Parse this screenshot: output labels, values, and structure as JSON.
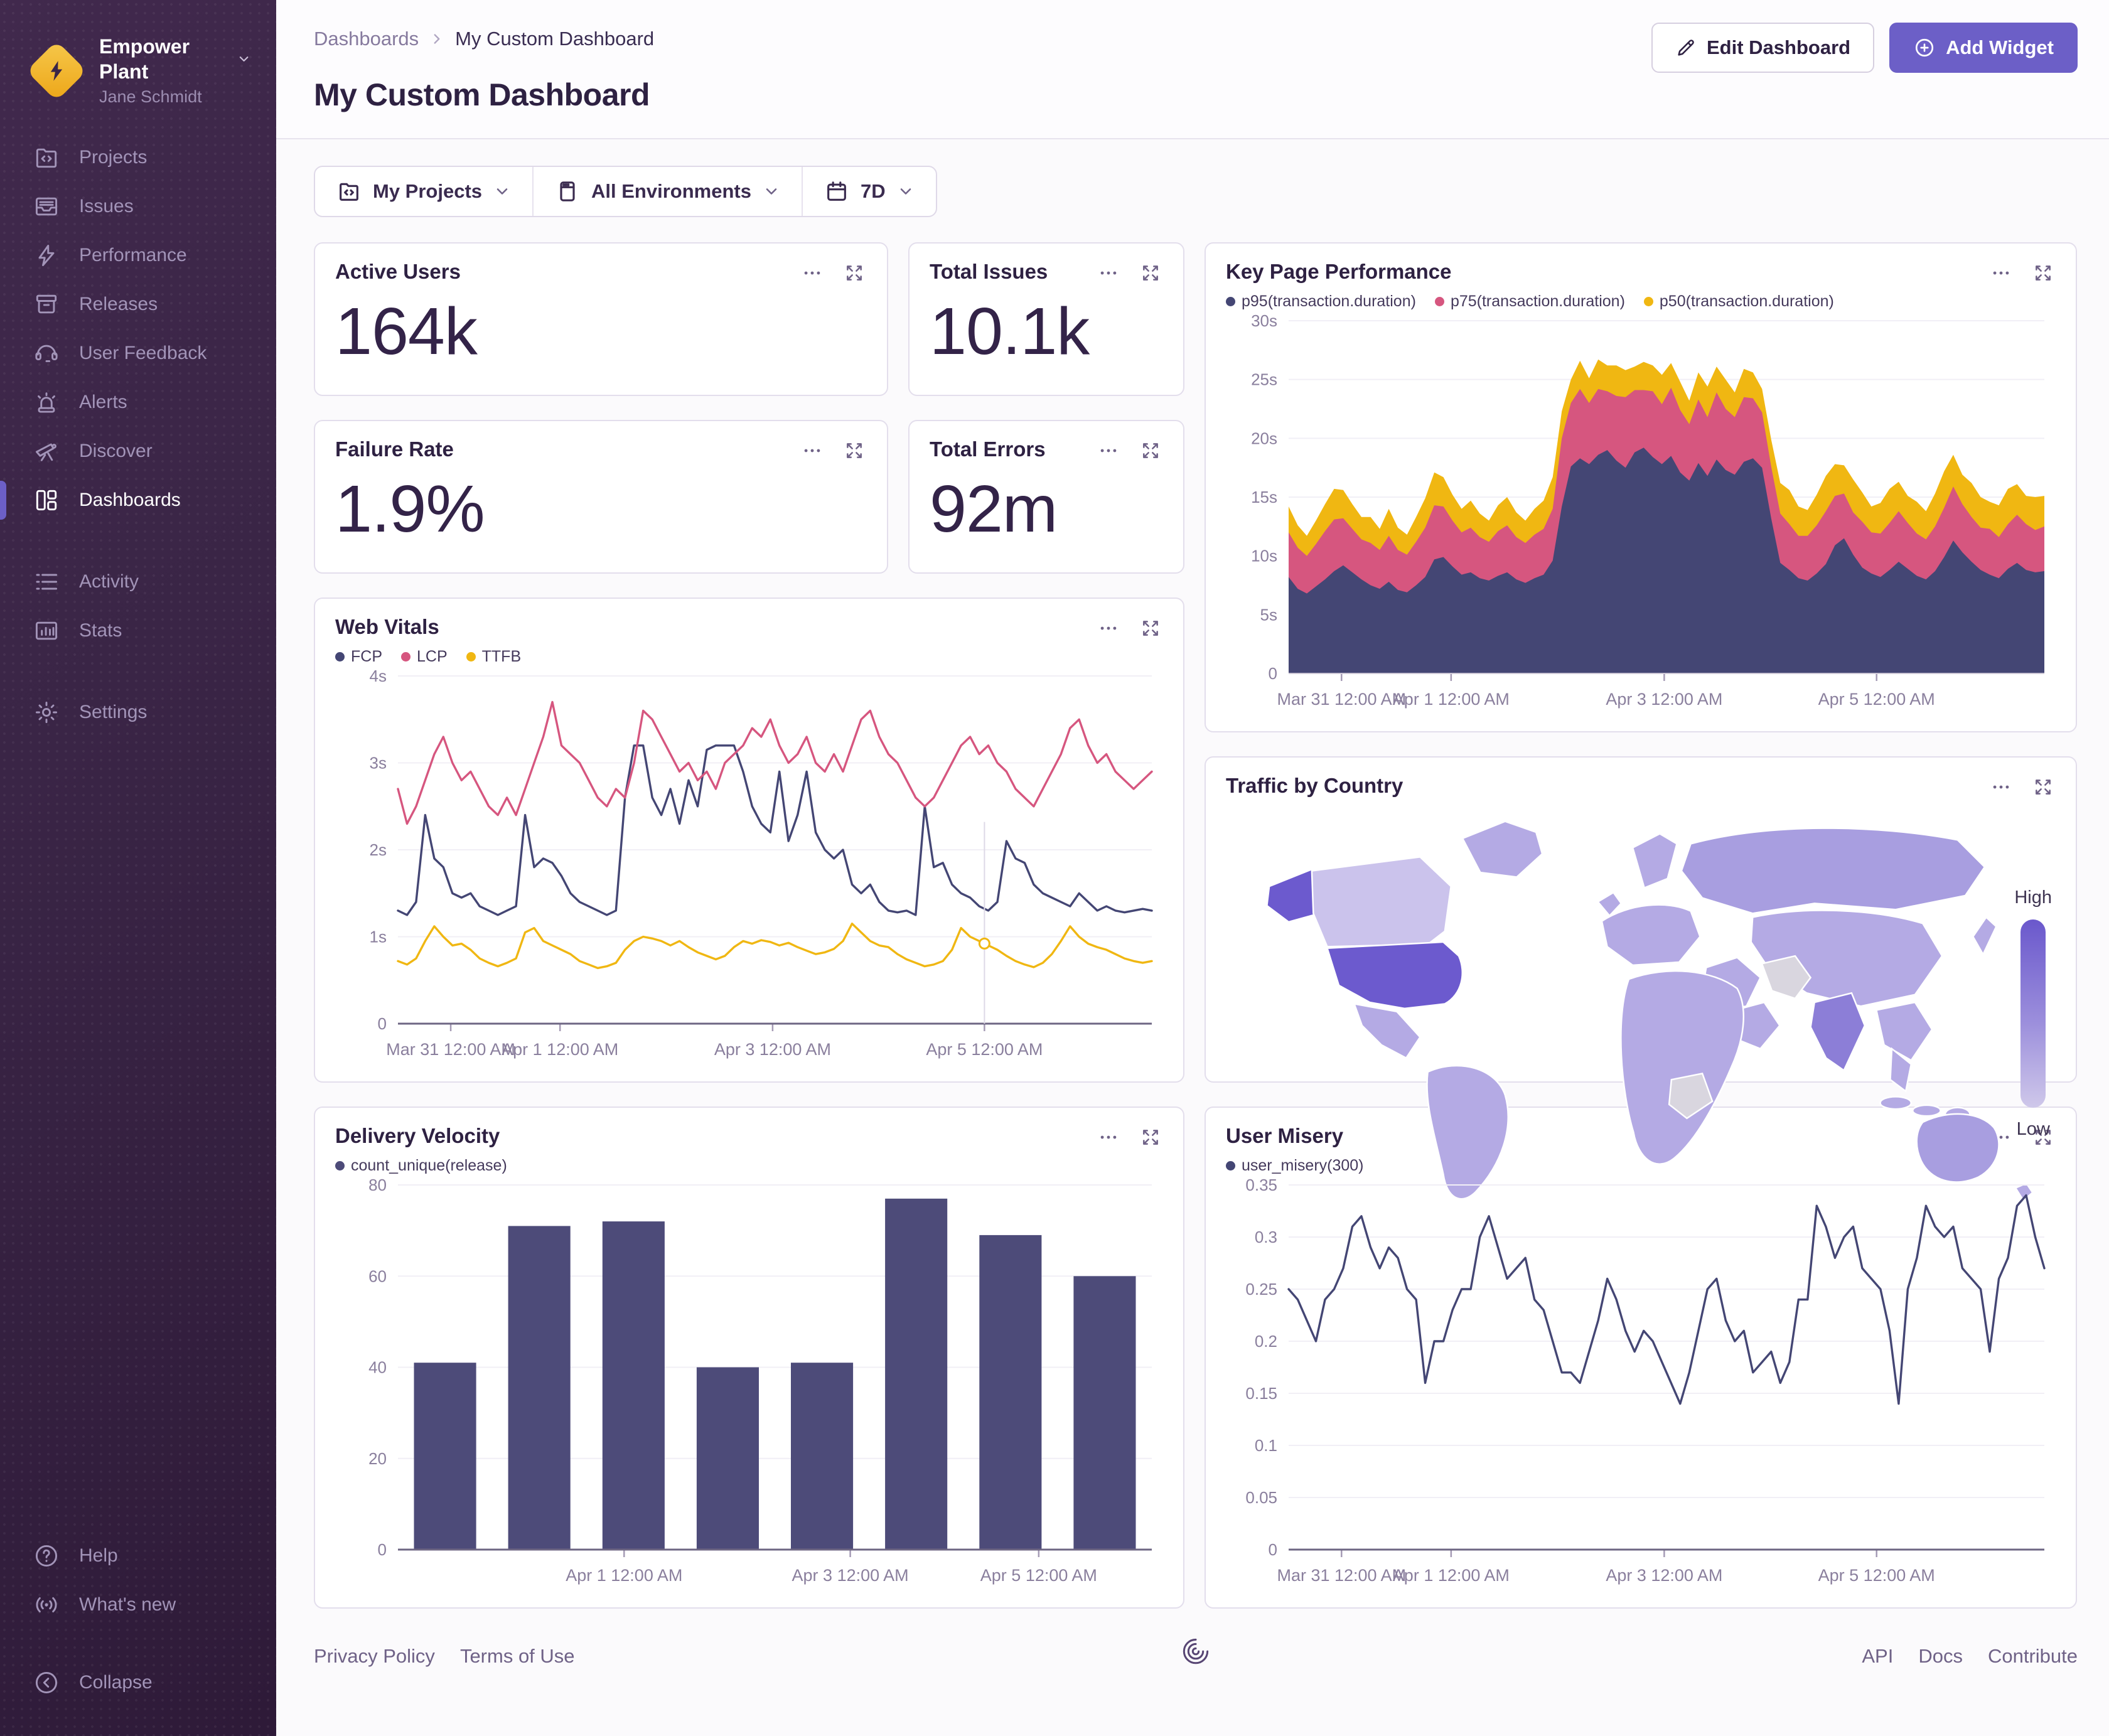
{
  "colors": {
    "accent": "#6C5FC7",
    "navy": "#444674",
    "pink": "#d6567f",
    "yellow": "#f0b712",
    "sidebar_bg": "#34203f",
    "text_dark": "#2e2142"
  },
  "sidebar": {
    "org": {
      "name": "Empower Plant",
      "user": "Jane Schmidt"
    },
    "items": [
      {
        "id": "projects",
        "label": "Projects",
        "group": 1
      },
      {
        "id": "issues",
        "label": "Issues",
        "group": 1
      },
      {
        "id": "performance",
        "label": "Performance",
        "group": 1
      },
      {
        "id": "releases",
        "label": "Releases",
        "group": 1
      },
      {
        "id": "feedback",
        "label": "User Feedback",
        "group": 1
      },
      {
        "id": "alerts",
        "label": "Alerts",
        "group": 1
      },
      {
        "id": "discover",
        "label": "Discover",
        "group": 1
      },
      {
        "id": "dashboards",
        "label": "Dashboards",
        "group": 1,
        "active": true
      },
      {
        "id": "activity",
        "label": "Activity",
        "group": 2
      },
      {
        "id": "stats",
        "label": "Stats",
        "group": 2
      },
      {
        "id": "settings",
        "label": "Settings",
        "group": 3
      }
    ],
    "footer_items": [
      {
        "id": "help",
        "label": "Help",
        "group": 1
      },
      {
        "id": "whatsnew",
        "label": "What's new",
        "group": 1
      },
      {
        "id": "collapse",
        "label": "Collapse",
        "group": 2
      }
    ]
  },
  "header": {
    "breadcrumb": {
      "parent": "Dashboards",
      "current": "My Custom Dashboard"
    },
    "title": "My Custom Dashboard",
    "edit_button": "Edit Dashboard",
    "add_button": "Add Widget"
  },
  "filters": {
    "projects": {
      "label": "My Projects"
    },
    "environments": {
      "label": "All Environments"
    },
    "period": {
      "label": "7D"
    }
  },
  "stats": {
    "active_users": {
      "title": "Active Users",
      "value": "164k"
    },
    "total_issues": {
      "title": "Total Issues",
      "value": "10.1k"
    },
    "failure_rate": {
      "title": "Failure Rate",
      "value": "1.9%"
    },
    "total_errors": {
      "title": "Total Errors",
      "value": "92m"
    }
  },
  "chart_data": [
    {
      "id": "key-page-performance",
      "type": "area",
      "stacked": true,
      "title": "Key Page Performance",
      "legend": [
        "p95(transaction.duration)",
        "p75(transaction.duration)",
        "p50(transaction.duration)"
      ],
      "ylim": [
        0,
        30
      ],
      "dark_axis": false,
      "yticks": [
        {
          "v": 0,
          "label": "0"
        },
        {
          "v": 5,
          "label": "5s"
        },
        {
          "v": 10,
          "label": "10s"
        },
        {
          "v": 15,
          "label": "15s"
        },
        {
          "v": 20,
          "label": "20s"
        },
        {
          "v": 25,
          "label": "25s"
        },
        {
          "v": 30,
          "label": "30s"
        }
      ],
      "xticks": [
        {
          "f": 0.07,
          "label": "Mar 31 12:00 AM"
        },
        {
          "f": 0.215,
          "label": "Apr 1 12:00 AM"
        },
        {
          "f": 0.497,
          "label": "Apr 3 12:00 AM"
        },
        {
          "f": 0.778,
          "label": "Apr 5 12:00 AM"
        }
      ],
      "series": [
        {
          "name": "p95(transaction.duration)",
          "color": "#444674",
          "values": [
            8.2,
            7.2,
            6.8,
            7.4,
            8.0,
            8.7,
            9.2,
            8.6,
            8.0,
            7.5,
            7.2,
            7.8,
            7.1,
            6.9,
            7.5,
            8.2,
            9.7,
            9.9,
            9.1,
            8.4,
            8.6,
            8.1,
            7.9,
            8.3,
            8.6,
            8.0,
            7.7,
            8.1,
            8.4,
            9.6,
            14.2,
            17.6,
            18.3,
            17.8,
            18.6,
            19.0,
            18.1,
            17.5,
            18.8,
            19.2,
            18.4,
            17.8,
            18.5,
            17.1,
            16.4,
            17.9,
            16.8,
            18.2,
            17.3,
            16.9,
            18.0,
            18.3,
            17.5,
            13.2,
            9.4,
            8.8,
            8.1,
            7.9,
            8.5,
            9.3,
            10.9,
            11.5,
            10.1,
            9.0,
            8.5,
            8.2,
            8.8,
            9.5,
            8.9,
            8.3,
            8.0,
            8.7,
            9.9,
            11.3,
            10.3,
            9.5,
            8.8,
            8.4,
            8.1,
            8.9,
            9.4,
            8.8,
            8.6,
            8.7
          ]
        },
        {
          "name": "p75(transaction.duration)",
          "color": "#d6567f",
          "values": [
            3.8,
            3.5,
            3.2,
            3.6,
            4.1,
            4.4,
            4.0,
            3.7,
            3.4,
            3.6,
            3.3,
            3.9,
            3.4,
            3.2,
            3.7,
            4.2,
            4.6,
            4.3,
            3.9,
            3.6,
            3.8,
            3.5,
            3.3,
            3.8,
            4.0,
            3.6,
            3.4,
            3.7,
            3.9,
            4.4,
            5.8,
            5.4,
            5.9,
            5.2,
            5.6,
            5.0,
            5.5,
            6.0,
            5.3,
            4.9,
            5.6,
            5.1,
            5.8,
            5.3,
            4.8,
            5.4,
            5.0,
            5.7,
            5.2,
            4.9,
            5.5,
            5.1,
            4.7,
            4.4,
            4.2,
            3.9,
            3.6,
            3.8,
            4.1,
            4.5,
            4.2,
            3.8,
            3.6,
            3.9,
            3.5,
            3.7,
            4.0,
            4.3,
            3.9,
            3.6,
            3.4,
            3.8,
            4.2,
            4.6,
            4.1,
            3.8,
            3.6,
            3.9,
            3.5,
            3.8,
            4.1,
            3.9,
            3.6,
            3.8
          ]
        },
        {
          "name": "p50(transaction.duration)",
          "color": "#f0b712",
          "values": [
            2.2,
            1.9,
            1.7,
            2.0,
            2.3,
            2.6,
            2.4,
            2.1,
            1.9,
            2.2,
            1.8,
            2.3,
            1.9,
            1.7,
            2.1,
            2.5,
            2.8,
            2.5,
            2.2,
            2.0,
            2.3,
            2.0,
            1.8,
            2.2,
            2.4,
            2.1,
            1.9,
            2.2,
            2.4,
            2.7,
            2.3,
            2.0,
            2.4,
            2.1,
            2.5,
            2.2,
            2.6,
            2.3,
            2.0,
            2.4,
            2.2,
            2.5,
            2.1,
            2.4,
            2.0,
            2.3,
            2.6,
            2.2,
            2.5,
            2.1,
            2.4,
            2.2,
            2.0,
            2.3,
            2.6,
            2.9,
            2.5,
            2.2,
            2.6,
            3.0,
            2.7,
            2.4,
            2.8,
            2.5,
            2.2,
            2.6,
            2.9,
            2.5,
            2.3,
            2.7,
            2.4,
            2.8,
            3.1,
            2.7,
            2.5,
            2.9,
            2.6,
            2.3,
            2.7,
            3.0,
            2.6,
            2.4,
            2.8,
            2.6
          ]
        }
      ]
    },
    {
      "id": "web-vitals",
      "type": "line",
      "title": "Web Vitals",
      "legend": [
        "FCP",
        "LCP",
        "TTFB"
      ],
      "ylim": [
        0,
        4
      ],
      "dark_axis": true,
      "yticks": [
        {
          "v": 0,
          "label": "0"
        },
        {
          "v": 1,
          "label": "1s"
        },
        {
          "v": 2,
          "label": "2s"
        },
        {
          "v": 3,
          "label": "3s"
        },
        {
          "v": 4,
          "label": "4s"
        }
      ],
      "xticks": [
        {
          "f": 0.07,
          "label": "Mar 31 12:00 AM"
        },
        {
          "f": 0.215,
          "label": "Apr 1 12:00 AM"
        },
        {
          "f": 0.497,
          "label": "Apr 3 12:00 AM"
        },
        {
          "f": 0.778,
          "label": "Apr 5 12:00 AM"
        }
      ],
      "crosshair": {
        "f": 0.778,
        "series": 2
      },
      "series": [
        {
          "name": "FCP",
          "color": "#444674",
          "values": [
            1.3,
            1.25,
            1.4,
            2.4,
            1.9,
            1.8,
            1.5,
            1.45,
            1.5,
            1.35,
            1.3,
            1.25,
            1.3,
            1.35,
            2.4,
            1.8,
            1.9,
            1.85,
            1.7,
            1.5,
            1.4,
            1.35,
            1.3,
            1.25,
            1.3,
            2.6,
            3.2,
            3.2,
            2.6,
            2.4,
            2.7,
            2.3,
            2.8,
            2.5,
            3.15,
            3.2,
            3.2,
            3.2,
            2.9,
            2.5,
            2.3,
            2.2,
            2.9,
            2.1,
            2.4,
            2.9,
            2.2,
            2.0,
            1.9,
            2.0,
            1.6,
            1.5,
            1.6,
            1.4,
            1.3,
            1.28,
            1.3,
            1.25,
            2.5,
            1.8,
            1.85,
            1.6,
            1.5,
            1.45,
            1.35,
            1.3,
            1.4,
            2.1,
            1.9,
            1.85,
            1.6,
            1.5,
            1.45,
            1.4,
            1.35,
            1.5,
            1.4,
            1.3,
            1.35,
            1.3,
            1.28,
            1.3,
            1.32,
            1.3
          ]
        },
        {
          "name": "LCP",
          "color": "#d6567f",
          "values": [
            2.7,
            2.3,
            2.5,
            2.8,
            3.1,
            3.3,
            3.0,
            2.8,
            2.9,
            2.7,
            2.5,
            2.4,
            2.6,
            2.4,
            2.7,
            3.0,
            3.3,
            3.7,
            3.2,
            3.1,
            3.0,
            2.8,
            2.6,
            2.5,
            2.7,
            2.6,
            3.0,
            3.6,
            3.5,
            3.3,
            3.1,
            2.9,
            3.0,
            2.8,
            2.9,
            2.7,
            3.0,
            3.1,
            3.2,
            3.4,
            3.3,
            3.5,
            3.2,
            3.0,
            3.1,
            3.3,
            3.0,
            2.9,
            3.1,
            2.9,
            3.2,
            3.5,
            3.6,
            3.3,
            3.1,
            3.0,
            2.8,
            2.6,
            2.5,
            2.6,
            2.8,
            3.0,
            3.2,
            3.3,
            3.1,
            3.2,
            3.0,
            2.9,
            2.7,
            2.6,
            2.5,
            2.7,
            2.9,
            3.1,
            3.4,
            3.5,
            3.2,
            3.0,
            3.1,
            2.9,
            2.8,
            2.7,
            2.8,
            2.9
          ]
        },
        {
          "name": "TTFB",
          "color": "#f0b712",
          "values": [
            0.72,
            0.68,
            0.75,
            0.95,
            1.12,
            1.0,
            0.9,
            0.92,
            0.85,
            0.75,
            0.7,
            0.66,
            0.7,
            0.75,
            1.05,
            1.1,
            0.95,
            0.9,
            0.85,
            0.8,
            0.72,
            0.68,
            0.64,
            0.66,
            0.7,
            0.85,
            0.95,
            1.0,
            0.98,
            0.95,
            0.9,
            0.95,
            0.88,
            0.82,
            0.78,
            0.74,
            0.78,
            0.88,
            0.95,
            0.92,
            0.96,
            0.94,
            0.9,
            0.93,
            0.88,
            0.84,
            0.8,
            0.82,
            0.86,
            0.95,
            1.15,
            1.05,
            0.95,
            0.9,
            0.88,
            0.8,
            0.74,
            0.7,
            0.66,
            0.68,
            0.72,
            0.85,
            1.1,
            1.0,
            0.95,
            0.9,
            0.85,
            0.78,
            0.72,
            0.68,
            0.65,
            0.7,
            0.8,
            0.95,
            1.12,
            1.0,
            0.92,
            0.88,
            0.85,
            0.8,
            0.75,
            0.72,
            0.7,
            0.72
          ]
        }
      ]
    },
    {
      "id": "traffic-by-country",
      "type": "choropleth",
      "title": "Traffic by Country",
      "legend": {
        "high": "High",
        "low": "Low"
      },
      "regions": [
        {
          "name": "United States",
          "level": "high"
        },
        {
          "name": "Alaska (US)",
          "level": "high"
        },
        {
          "name": "India",
          "level": "medium-high"
        },
        {
          "name": "Russia",
          "level": "medium"
        },
        {
          "name": "China",
          "level": "medium"
        },
        {
          "name": "Europe",
          "level": "medium"
        },
        {
          "name": "South America",
          "level": "medium"
        },
        {
          "name": "Africa",
          "level": "medium"
        },
        {
          "name": "Australia",
          "level": "medium"
        },
        {
          "name": "Mexico",
          "level": "medium"
        },
        {
          "name": "Canada",
          "level": "low"
        },
        {
          "name": "Greenland",
          "level": "low"
        },
        {
          "name": "Iran",
          "level": "none"
        },
        {
          "name": "Central Africa",
          "level": "none"
        }
      ]
    },
    {
      "id": "delivery-velocity",
      "type": "bar",
      "title": "Delivery Velocity",
      "legend": [
        "count_unique(release)"
      ],
      "ylim": [
        0,
        80
      ],
      "dark_axis": true,
      "yticks": [
        {
          "v": 0,
          "label": "0"
        },
        {
          "v": 20,
          "label": "20"
        },
        {
          "v": 40,
          "label": "40"
        },
        {
          "v": 60,
          "label": "60"
        },
        {
          "v": 80,
          "label": "80"
        }
      ],
      "xticks": [
        {
          "f": 0.3,
          "label": "Apr 1 12:00 AM"
        },
        {
          "f": 0.6,
          "label": "Apr 3 12:00 AM"
        },
        {
          "f": 0.85,
          "label": "Apr 5 12:00 AM"
        }
      ],
      "bar_color": "#4d4b79",
      "values": [
        41,
        71,
        72,
        40,
        41,
        77,
        69,
        60
      ]
    },
    {
      "id": "user-misery",
      "type": "line",
      "title": "User Misery",
      "legend": [
        "user_misery(300)"
      ],
      "ylim": [
        0,
        0.35
      ],
      "dark_axis": true,
      "yticks": [
        {
          "v": 0,
          "label": "0"
        },
        {
          "v": 0.05,
          "label": "0.05"
        },
        {
          "v": 0.1,
          "label": "0.1"
        },
        {
          "v": 0.15,
          "label": "0.15"
        },
        {
          "v": 0.2,
          "label": "0.2"
        },
        {
          "v": 0.25,
          "label": "0.25"
        },
        {
          "v": 0.3,
          "label": "0.3"
        },
        {
          "v": 0.35,
          "label": "0.35"
        }
      ],
      "xticks": [
        {
          "f": 0.07,
          "label": "Mar 31 12:00 AM"
        },
        {
          "f": 0.215,
          "label": "Apr 1 12:00 AM"
        },
        {
          "f": 0.497,
          "label": "Apr 3 12:00 AM"
        },
        {
          "f": 0.778,
          "label": "Apr 5 12:00 AM"
        }
      ],
      "series": [
        {
          "name": "user_misery(300)",
          "color": "#444674",
          "values": [
            0.25,
            0.24,
            0.22,
            0.2,
            0.24,
            0.25,
            0.27,
            0.31,
            0.32,
            0.29,
            0.27,
            0.29,
            0.28,
            0.25,
            0.24,
            0.16,
            0.2,
            0.2,
            0.23,
            0.25,
            0.25,
            0.3,
            0.32,
            0.29,
            0.26,
            0.27,
            0.28,
            0.24,
            0.23,
            0.2,
            0.17,
            0.17,
            0.16,
            0.19,
            0.22,
            0.26,
            0.24,
            0.21,
            0.19,
            0.21,
            0.2,
            0.18,
            0.16,
            0.14,
            0.17,
            0.21,
            0.25,
            0.26,
            0.22,
            0.2,
            0.21,
            0.17,
            0.18,
            0.19,
            0.16,
            0.18,
            0.24,
            0.24,
            0.33,
            0.31,
            0.28,
            0.3,
            0.31,
            0.27,
            0.26,
            0.25,
            0.21,
            0.14,
            0.25,
            0.28,
            0.33,
            0.31,
            0.3,
            0.31,
            0.27,
            0.26,
            0.25,
            0.19,
            0.26,
            0.28,
            0.33,
            0.34,
            0.3,
            0.27
          ]
        }
      ]
    }
  ],
  "footer": {
    "links_left": [
      "Privacy Policy",
      "Terms of Use"
    ],
    "links_right": [
      "API",
      "Docs",
      "Contribute"
    ]
  }
}
